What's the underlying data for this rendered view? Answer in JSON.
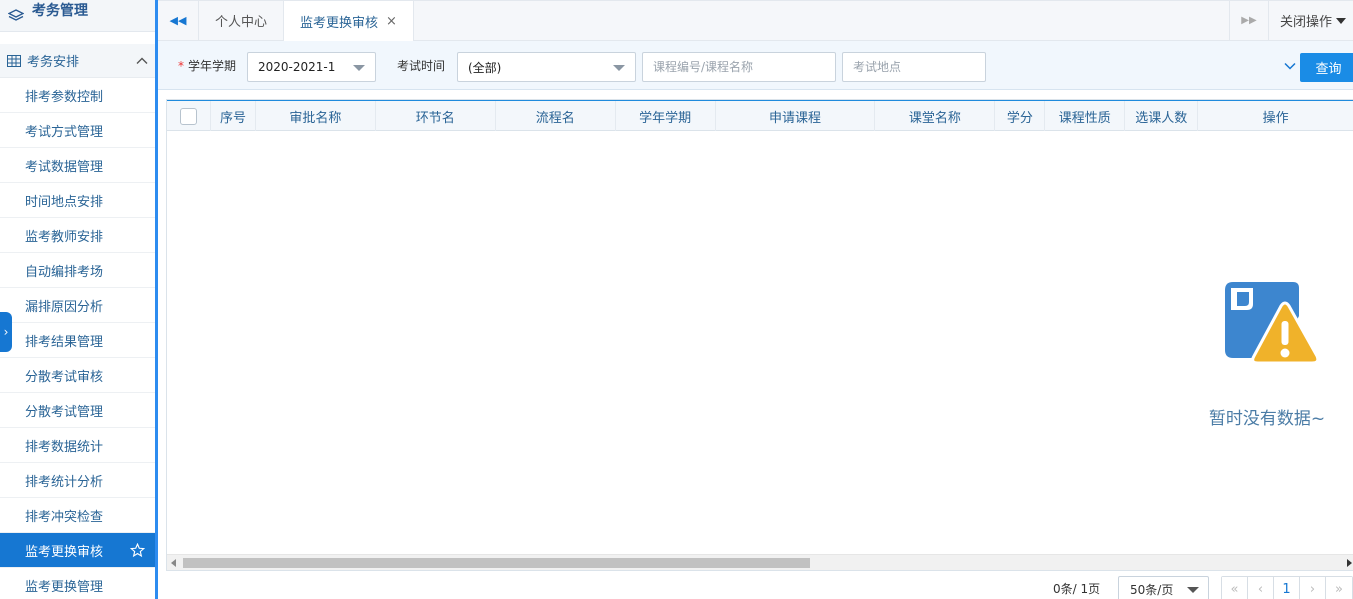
{
  "sidebar": {
    "title": "考务管理",
    "group_label": "考务安排",
    "items": [
      "排考参数控制",
      "考试方式管理",
      "考试数据管理",
      "时间地点安排",
      "监考教师安排",
      "自动编排考场",
      "漏排原因分析",
      "排考结果管理",
      "分散考试审核",
      "分散考试管理",
      "排考数据统计",
      "排考统计分析",
      "排考冲突检查",
      "监考更换审核",
      "监考更换管理"
    ],
    "active_index": 13
  },
  "tabs": {
    "items": [
      {
        "label": "个人中心",
        "active": false
      },
      {
        "label": "监考更换审核",
        "active": true,
        "close": "×"
      }
    ],
    "close_ops_label": "关闭操作"
  },
  "filters": {
    "term_label": "学年学期",
    "required_mark": "*",
    "term_value": "2020-2021-1",
    "exam_time_label": "考试时间",
    "exam_time_value": "(全部)",
    "course_placeholder": "课程编号/课程名称",
    "location_placeholder": "考试地点",
    "query_label": "查询"
  },
  "table": {
    "columns": [
      "序号",
      "审批名称",
      "环节名",
      "流程名",
      "学年学期",
      "申请课程",
      "课堂名称",
      "学分",
      "课程性质",
      "选课人数",
      "操作"
    ],
    "rows": [],
    "empty_message": "暂时没有数据~"
  },
  "pager": {
    "records": "0条/",
    "pages": "1页",
    "page_size": "50条/页",
    "current_page": "1"
  },
  "colors": {
    "primary": "#1677d2",
    "accent_blue": "#1a8ce6",
    "warning": "#f0b22a"
  }
}
